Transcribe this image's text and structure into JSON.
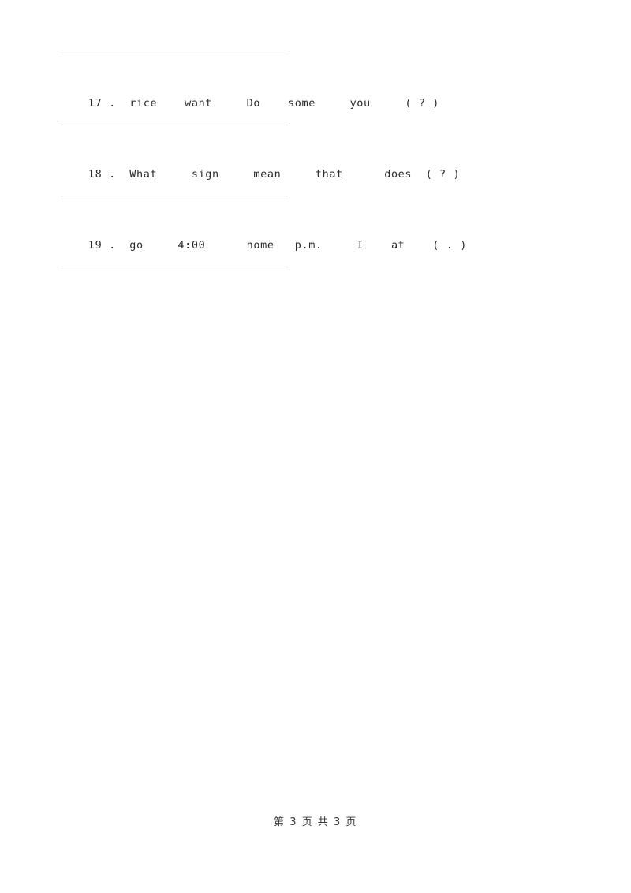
{
  "document": {
    "background_color": "#ffffff",
    "text_color": "#2b2b2b",
    "rule_color": "#c9c9c9"
  },
  "questions": [
    {
      "number": "17 .",
      "text": "rice    want     Do    some     you     ( ? )",
      "full": "17 .  rice    want     Do    some     you     ( ? )"
    },
    {
      "number": "18 .",
      "text": "What     sign     mean     that      does  ( ? )",
      "full": "18 .  What     sign     mean     that      does  ( ? )"
    },
    {
      "number": "19 .",
      "text": "go     4:00      home   p.m.     I    at    ( . )",
      "full": "19 .  go     4:00      home   p.m.     I    at    ( . )"
    }
  ],
  "answer_rules": [
    {
      "id": "rule-above-q17"
    },
    {
      "id": "rule-below-q17"
    },
    {
      "id": "rule-below-q18"
    },
    {
      "id": "rule-below-q19"
    }
  ],
  "footer": {
    "text": "第 3 页 共 3 页",
    "current_page": "3",
    "total_pages": "3"
  }
}
